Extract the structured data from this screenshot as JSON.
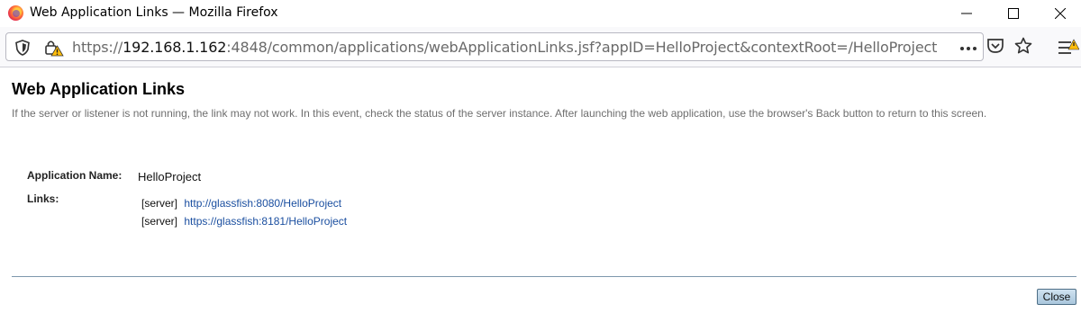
{
  "window": {
    "title": "Web Application Links — Mozilla Firefox"
  },
  "navbar": {
    "url_prefix": "https://",
    "url_host": "192.168.1.162",
    "url_rest": ":4848/common/applications/webApplicationLinks.jsf?appID=HelloProject&contextRoot=/HelloProject",
    "icons": [
      "shield-icon",
      "lock-warning-icon",
      "more-dots-icon",
      "pocket-icon",
      "bookmark-star-icon",
      "hamburger-menu-icon"
    ]
  },
  "page": {
    "title": "Web Application Links",
    "help_text": "If the server or listener is not running, the link may not work. In this event, check the status of the server instance. After launching the web application, use the browser's Back button to return to this screen.",
    "app_name_label": "Application Name:",
    "app_name_value": "HelloProject",
    "links_label": "Links:",
    "links": [
      {
        "prefix": "[server]",
        "url": "http://glassfish:8080/HelloProject"
      },
      {
        "prefix": "[server]",
        "url": "https://glassfish:8181/HelloProject"
      }
    ],
    "close_label": "Close"
  },
  "colors": {
    "link": "#1b4fa0",
    "help_text": "#6e6e6e",
    "divider": "#7d97ad",
    "close_button": "#a9c6dc"
  }
}
